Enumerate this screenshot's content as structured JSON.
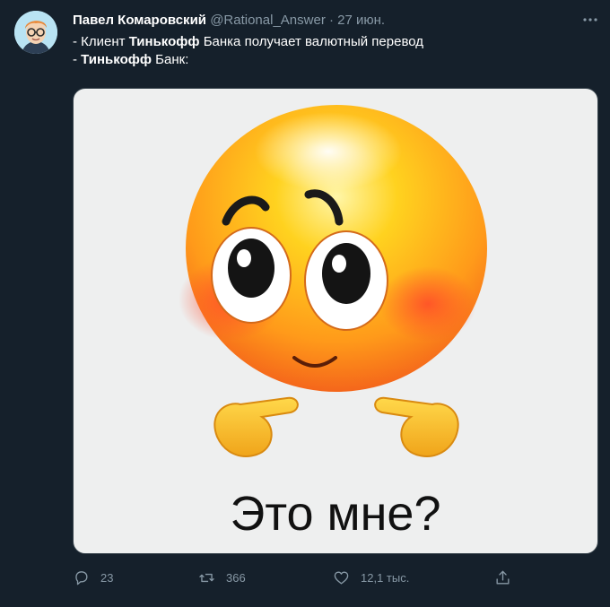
{
  "author": {
    "name": "Павел Комаровский",
    "handle": "@Rational_Answer",
    "separator": "·",
    "date": "27 июн."
  },
  "tweet": {
    "line1": {
      "prefix": "- Клиент ",
      "bold": "Тинькофф",
      "suffix": " Банка получает валютный перевод"
    },
    "line2": {
      "prefix": "- ",
      "bold": "Тинькофф",
      "suffix": " Банк:"
    }
  },
  "media": {
    "caption": "Это мне?"
  },
  "actions": {
    "reply_count": "23",
    "retweet_count": "366",
    "like_count": "12,1 тыс."
  },
  "colors": {
    "background": "#15202b",
    "secondary_text": "#8899a6",
    "primary_text": "#ffffff",
    "emoji_yellow": "#ffc61a",
    "emoji_orange": "#f66b1f"
  },
  "icons": {
    "more": "more-dots-icon",
    "reply": "reply-icon",
    "retweet": "retweet-icon",
    "like": "heart-icon",
    "share": "share-icon"
  }
}
